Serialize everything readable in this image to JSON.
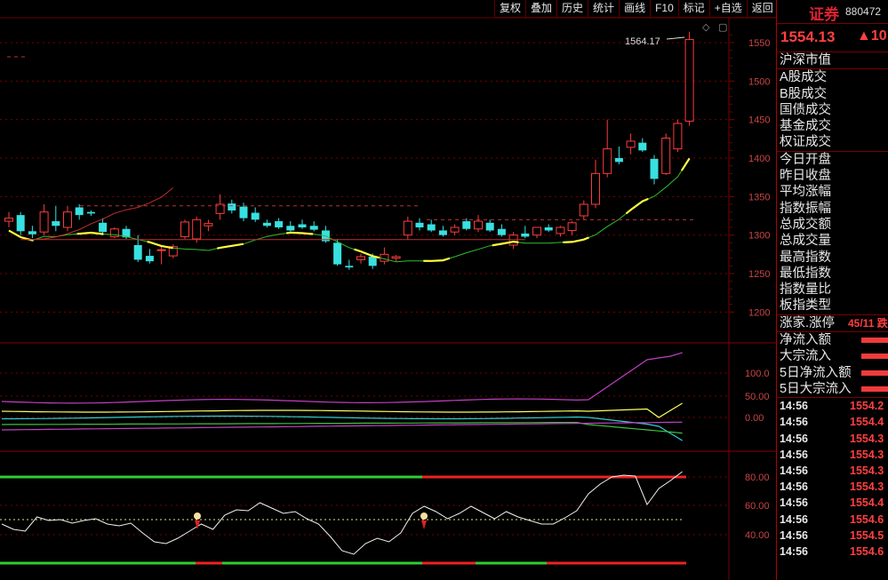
{
  "toolbar": [
    "复权",
    "叠加",
    "历史",
    "统计",
    "画线",
    "F10",
    "标记",
    "+自选",
    "返回"
  ],
  "panel": {
    "title": "证券",
    "code": "880472",
    "price": "1554.13",
    "change": "▲10",
    "group1": [
      "沪深市值"
    ],
    "group2": [
      "A股成交",
      "B股成交",
      "国债成交",
      "基金成交",
      "权证成交"
    ],
    "group3": [
      "今日开盘",
      "昨日收盘",
      "平均涨幅",
      "指数振幅",
      "总成交额",
      "总成交量",
      "最高指数",
      "最低指数",
      "指数量比",
      "板指类型"
    ],
    "zhangting_label": "涨家.涨停",
    "zhangting_value": "45/11 跌",
    "flows": [
      "净流入额",
      "大宗流入",
      "5日净流入额",
      "5日大宗流入"
    ],
    "ticks": [
      {
        "t": "14:56",
        "p": "1554.2"
      },
      {
        "t": "14:56",
        "p": "1554.4"
      },
      {
        "t": "14:56",
        "p": "1554.3"
      },
      {
        "t": "14:56",
        "p": "1554.3"
      },
      {
        "t": "14:56",
        "p": "1554.3"
      },
      {
        "t": "14:56",
        "p": "1554.3"
      },
      {
        "t": "14:56",
        "p": "1554.4"
      },
      {
        "t": "14:56",
        "p": "1554.6"
      },
      {
        "t": "14:56",
        "p": "1554.5"
      },
      {
        "t": "14:56",
        "p": "1554.6"
      }
    ]
  },
  "chart_data": {
    "type": "candlestick",
    "price_axis": {
      "ticks": [
        "1550",
        "1500",
        "1450",
        "1400",
        "1350",
        "1300",
        "1250",
        "1200"
      ],
      "range": [
        1160,
        1580
      ]
    },
    "max_label": "1564.17",
    "candles": [
      {
        "o": 1318,
        "h": 1330,
        "l": 1310,
        "c": 1322
      },
      {
        "o": 1326,
        "h": 1330,
        "l": 1300,
        "c": 1305
      },
      {
        "o": 1305,
        "h": 1312,
        "l": 1296,
        "c": 1301
      },
      {
        "o": 1304,
        "h": 1340,
        "l": 1300,
        "c": 1330
      },
      {
        "o": 1318,
        "h": 1338,
        "l": 1305,
        "c": 1312
      },
      {
        "o": 1310,
        "h": 1338,
        "l": 1305,
        "c": 1330
      },
      {
        "o": 1336,
        "h": 1340,
        "l": 1320,
        "c": 1326
      },
      {
        "o": 1330,
        "h": 1332,
        "l": 1325,
        "c": 1328
      },
      {
        "o": 1316,
        "h": 1322,
        "l": 1300,
        "c": 1304
      },
      {
        "o": 1298,
        "h": 1310,
        "l": 1296,
        "c": 1308
      },
      {
        "o": 1308,
        "h": 1312,
        "l": 1295,
        "c": 1297
      },
      {
        "o": 1287,
        "h": 1300,
        "l": 1265,
        "c": 1268
      },
      {
        "o": 1273,
        "h": 1282,
        "l": 1263,
        "c": 1266
      },
      {
        "o": 1280,
        "h": 1286,
        "l": 1262,
        "c": 1281
      },
      {
        "o": 1273,
        "h": 1288,
        "l": 1270,
        "c": 1285
      },
      {
        "o": 1298,
        "h": 1320,
        "l": 1295,
        "c": 1317
      },
      {
        "o": 1295,
        "h": 1324,
        "l": 1290,
        "c": 1320
      },
      {
        "o": 1312,
        "h": 1320,
        "l": 1305,
        "c": 1315
      },
      {
        "o": 1328,
        "h": 1353,
        "l": 1320,
        "c": 1340
      },
      {
        "o": 1341,
        "h": 1346,
        "l": 1328,
        "c": 1332
      },
      {
        "o": 1337,
        "h": 1342,
        "l": 1318,
        "c": 1322
      },
      {
        "o": 1329,
        "h": 1336,
        "l": 1317,
        "c": 1320
      },
      {
        "o": 1316,
        "h": 1320,
        "l": 1310,
        "c": 1312
      },
      {
        "o": 1318,
        "h": 1322,
        "l": 1308,
        "c": 1310
      },
      {
        "o": 1312,
        "h": 1318,
        "l": 1305,
        "c": 1306
      },
      {
        "o": 1314,
        "h": 1320,
        "l": 1308,
        "c": 1310
      },
      {
        "o": 1312,
        "h": 1318,
        "l": 1305,
        "c": 1307
      },
      {
        "o": 1306,
        "h": 1312,
        "l": 1290,
        "c": 1292
      },
      {
        "o": 1290,
        "h": 1295,
        "l": 1260,
        "c": 1262
      },
      {
        "o": 1260,
        "h": 1268,
        "l": 1255,
        "c": 1258
      },
      {
        "o": 1268,
        "h": 1276,
        "l": 1263,
        "c": 1272
      },
      {
        "o": 1272,
        "h": 1276,
        "l": 1256,
        "c": 1260
      },
      {
        "o": 1266,
        "h": 1284,
        "l": 1262,
        "c": 1275
      },
      {
        "o": 1270,
        "h": 1274,
        "l": 1266,
        "c": 1272
      },
      {
        "o": 1300,
        "h": 1324,
        "l": 1294,
        "c": 1318
      },
      {
        "o": 1316,
        "h": 1322,
        "l": 1306,
        "c": 1310
      },
      {
        "o": 1314,
        "h": 1320,
        "l": 1304,
        "c": 1306
      },
      {
        "o": 1306,
        "h": 1312,
        "l": 1298,
        "c": 1300
      },
      {
        "o": 1304,
        "h": 1314,
        "l": 1300,
        "c": 1310
      },
      {
        "o": 1318,
        "h": 1322,
        "l": 1306,
        "c": 1308
      },
      {
        "o": 1308,
        "h": 1326,
        "l": 1304,
        "c": 1318
      },
      {
        "o": 1316,
        "h": 1320,
        "l": 1304,
        "c": 1306
      },
      {
        "o": 1308,
        "h": 1314,
        "l": 1298,
        "c": 1300
      },
      {
        "o": 1287,
        "h": 1304,
        "l": 1282,
        "c": 1300
      },
      {
        "o": 1302,
        "h": 1312,
        "l": 1296,
        "c": 1298
      },
      {
        "o": 1300,
        "h": 1310,
        "l": 1296,
        "c": 1310
      },
      {
        "o": 1310,
        "h": 1314,
        "l": 1304,
        "c": 1306
      },
      {
        "o": 1302,
        "h": 1312,
        "l": 1298,
        "c": 1310
      },
      {
        "o": 1306,
        "h": 1318,
        "l": 1300,
        "c": 1316
      },
      {
        "o": 1325,
        "h": 1345,
        "l": 1320,
        "c": 1340
      },
      {
        "o": 1340,
        "h": 1398,
        "l": 1335,
        "c": 1380
      },
      {
        "o": 1380,
        "h": 1450,
        "l": 1375,
        "c": 1412
      },
      {
        "o": 1400,
        "h": 1415,
        "l": 1392,
        "c": 1395
      },
      {
        "o": 1414,
        "h": 1432,
        "l": 1405,
        "c": 1422
      },
      {
        "o": 1420,
        "h": 1426,
        "l": 1408,
        "c": 1410
      },
      {
        "o": 1399,
        "h": 1404,
        "l": 1366,
        "c": 1373
      },
      {
        "o": 1380,
        "h": 1432,
        "l": 1378,
        "c": 1426
      },
      {
        "o": 1412,
        "h": 1450,
        "l": 1408,
        "c": 1445
      },
      {
        "o": 1448,
        "h": 1564.17,
        "l": 1442,
        "c": 1554.13
      }
    ],
    "vol_axis": {
      "ticks": [
        "100.0",
        "50.00",
        "0.00"
      ]
    },
    "osc_axis": {
      "ticks": [
        "80.00",
        "60.00",
        "40.00"
      ]
    }
  }
}
